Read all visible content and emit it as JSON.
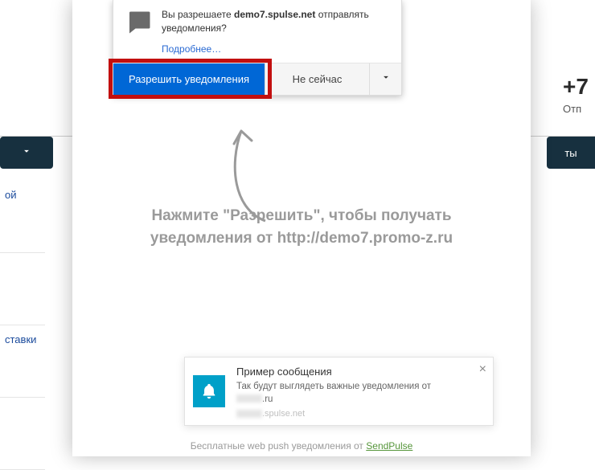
{
  "background": {
    "phone_fragment": "+7",
    "phone_sub": "Отп",
    "right_button_fragment": "ты",
    "sidebar_items": [
      "ой",
      "ставки"
    ]
  },
  "permission_dialog": {
    "question_prefix": "Вы разрешаете ",
    "domain": "demo7.spulse.net",
    "question_suffix": " отправлять уведомления?",
    "more_link": "Подробнее…",
    "allow_label": "Разрешить уведомления",
    "notnow_label": "Не сейчас"
  },
  "instruction": {
    "line1": "Нажмите \"Разрешить\", чтобы получать",
    "line2": "уведомления от http://demo7.promo-z.ru"
  },
  "toast": {
    "title": "Пример сообщения",
    "message": "Так будут выглядеть важные уведомления от",
    "masked_domain_suffix": ".ru",
    "source_suffix": ".spulse.net"
  },
  "footer": {
    "text": "Бесплатные web push уведомления от ",
    "link_label": "SendPulse"
  }
}
